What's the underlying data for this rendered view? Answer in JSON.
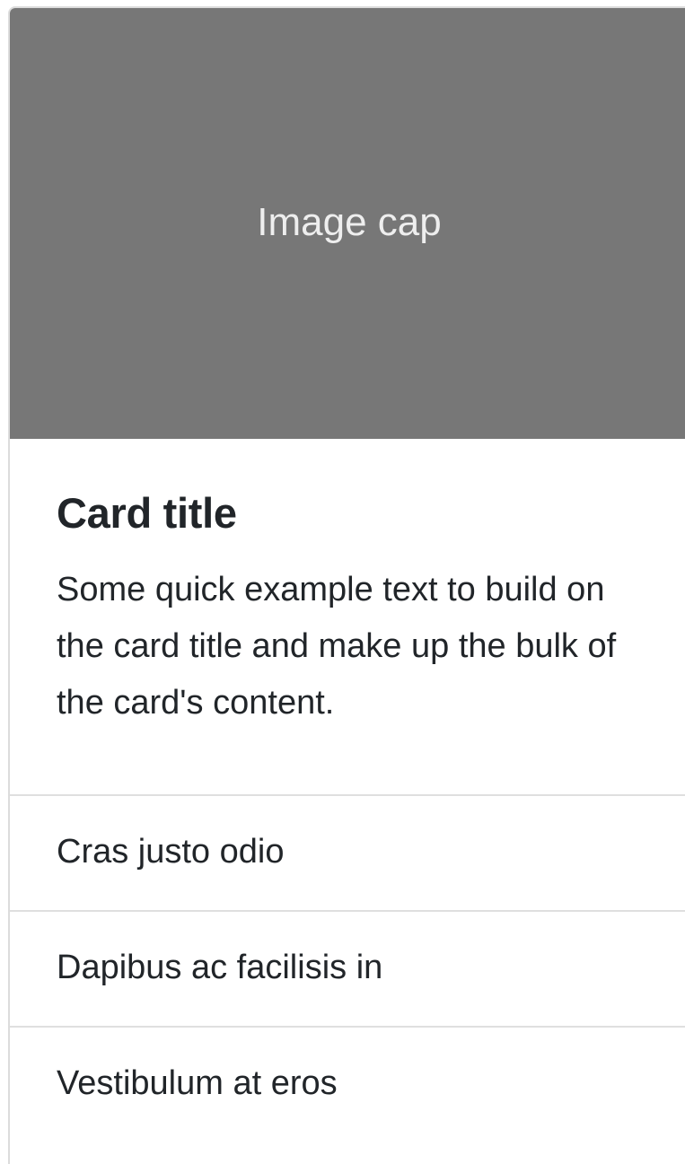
{
  "card": {
    "image_cap": "Image cap",
    "title": "Card title",
    "text": "Some quick example text to build on the card title and make up the bulk of the card's content.",
    "list_items": [
      {
        "label": "Cras justo odio"
      },
      {
        "label": "Dapibus ac facilisis in"
      },
      {
        "label": "Vestibulum at eros"
      }
    ]
  },
  "colors": {
    "image_cap_bg": "#777777",
    "image_cap_text": "#eeeeee",
    "text": "#212529",
    "border": "#dfdfdf"
  }
}
